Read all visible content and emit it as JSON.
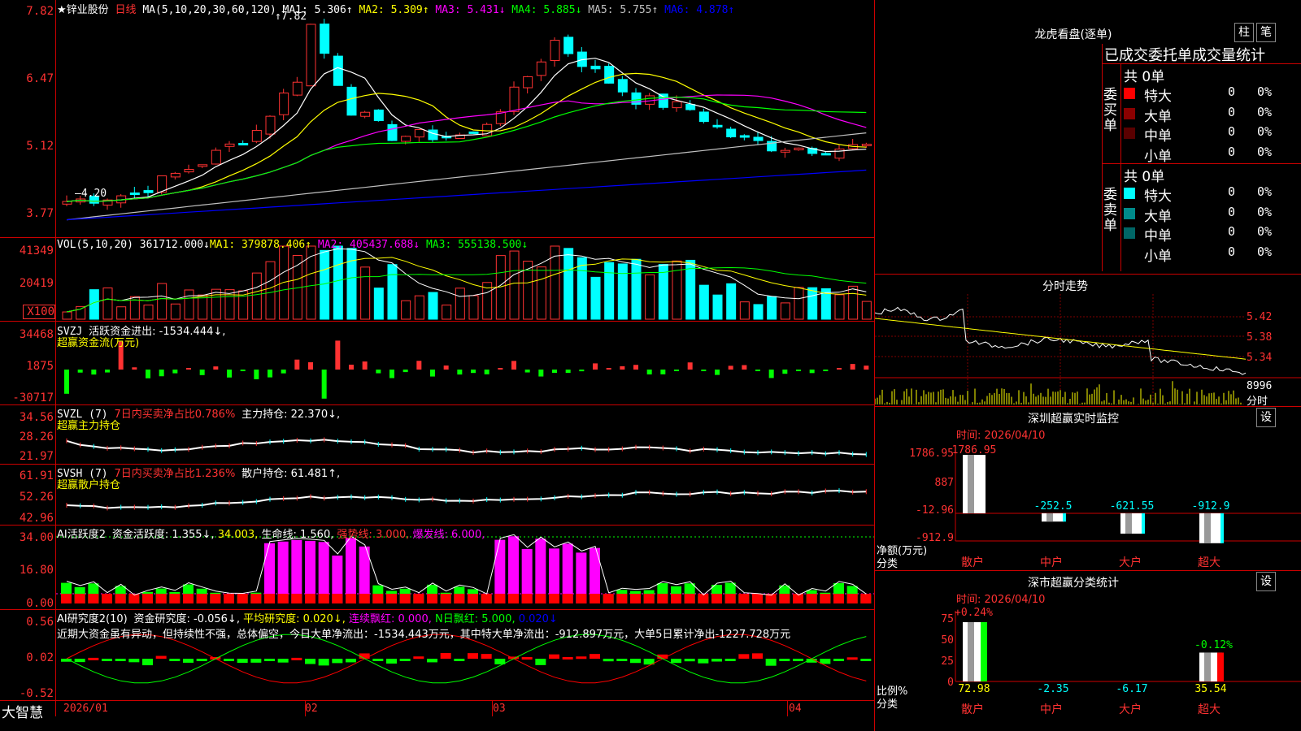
{
  "stock_title": "★锌业股份",
  "period": "日线",
  "main_indicator": {
    "label": "MA(5,10,20,30,60,120)",
    "items": [
      {
        "text": "MA1: 5.306↑",
        "color": "#ffffff"
      },
      {
        "text": "MA2: 5.309↑",
        "color": "#ffff00"
      },
      {
        "text": "MA3: 5.431↓",
        "color": "#ff00ff"
      },
      {
        "text": "MA4: 5.885↓",
        "color": "#00ff00"
      },
      {
        "text": "MA5: 5.755↑",
        "color": "#c0c0c0"
      },
      {
        "text": "MA6: 4.878↑",
        "color": "#0000ff"
      }
    ],
    "high_mark": "7.82",
    "low_mark": "4.20"
  },
  "price_axis": [
    "7.82",
    "6.47",
    "5.12",
    "3.77"
  ],
  "vol_panel": {
    "label": "VOL(5,10,20)",
    "value": "361712.000↓",
    "ma1": "MA1: 379878.406↑",
    "ma2": "MA2: 405437.688↓",
    "ma3": "MA3: 555138.500↓",
    "axis": [
      "41349",
      "20419",
      "X100"
    ]
  },
  "svzj_panel": {
    "label": "SVZJ",
    "title": "活跃资金进出: -1534.444↓,",
    "subtitle": "超赢资金流(万元)",
    "axis": [
      "34468",
      "1875",
      "-30717"
    ]
  },
  "svzl_panel": {
    "label": "SVZL (7)",
    "title": "7日内买卖净占比0.786%",
    "extra": "主力持仓: 22.370↓,",
    "subtitle": "超赢主力持仓",
    "axis": [
      "34.56",
      "28.26",
      "21.97"
    ]
  },
  "svsh_panel": {
    "label": "SVSH (7)",
    "title": "7日内买卖净占比1.236%",
    "extra": "散户持仓: 61.481↑,",
    "subtitle": "超赢散户持仓",
    "axis": [
      "61.91",
      "52.26",
      "42.96"
    ]
  },
  "ai_active_panel": {
    "label": "AI活跃度2",
    "items": [
      {
        "text": "资金活跃度: 1.355↓,",
        "color": "#ffffff"
      },
      {
        "text": "34.003,",
        "color": "#ffff00"
      },
      {
        "text": "生命线: 1.560,",
        "color": "#ffffff"
      },
      {
        "text": "强势线: 3.000,",
        "color": "#ff3232"
      },
      {
        "text": "爆发线: 6.000,",
        "color": "#ff00ff"
      }
    ],
    "axis": [
      "34.00",
      "16.80",
      "0.00"
    ]
  },
  "ai_research_panel": {
    "label": "AI研究度2(10)",
    "items": [
      {
        "text": "资金研究度: -0.056↓,",
        "color": "#ffffff"
      },
      {
        "text": "平均研究度: 0.020↓,",
        "color": "#ffff00"
      },
      {
        "text": "连续飘红: 0.000,",
        "color": "#ff00ff"
      },
      {
        "text": "N日飘红: 5.000,",
        "color": "#00ff00"
      },
      {
        "text": "0.020↓",
        "color": "#0000ff"
      }
    ],
    "comment": "近期大资金虽有异动，但持续性不强，总体偏空，今日大单净流出：-1534.443万元，其中特大单净流出：-912.897万元，大单5日累计净出-1227.728万元",
    "axis": [
      "0.56",
      "0.02",
      "-0.52"
    ]
  },
  "date_axis": [
    "2026/01",
    "02",
    "03",
    "04"
  ],
  "brand": "大智慧",
  "lhb": {
    "title": "龙虎看盘(逐单)",
    "btn_zhu": "柱",
    "btn_bi": "笔",
    "tabs": "已成交委托单成交量统计",
    "buy": {
      "side_label": "委买单",
      "total": "共 0单",
      "rows": [
        {
          "name": "特大",
          "val": "0",
          "pct": "0%",
          "color": "#ff0000"
        },
        {
          "name": "大单",
          "val": "0",
          "pct": "0%",
          "color": "#8b0000"
        },
        {
          "name": "中单",
          "val": "0",
          "pct": "0%",
          "color": "#5a0000"
        },
        {
          "name": "小单",
          "val": "0",
          "pct": "0%",
          "color": "#000000"
        }
      ]
    },
    "sell": {
      "side_label": "委卖单",
      "total": "共 0单",
      "rows": [
        {
          "name": "特大",
          "val": "0",
          "pct": "0%",
          "color": "#00ffff"
        },
        {
          "name": "大单",
          "val": "0",
          "pct": "0%",
          "color": "#008b8b"
        },
        {
          "name": "中单",
          "val": "0",
          "pct": "0%",
          "color": "#006666"
        },
        {
          "name": "小单",
          "val": "0",
          "pct": "0%",
          "color": "#000000"
        }
      ]
    }
  },
  "intraday": {
    "title": "分时走势",
    "prices": [
      "5.42",
      "5.38",
      "5.34"
    ],
    "vol_max": "8996",
    "footer": "分时"
  },
  "sz_monitor": {
    "title": "深圳超赢实时监控",
    "btn": "设",
    "time": "时间: 2026/04/10",
    "axis": [
      "1786.95",
      "887",
      "-12.96",
      "-912.9"
    ],
    "net_label": "净额(万元)",
    "cat_label": "分类",
    "cats": [
      "散户",
      "中户",
      "大户",
      "超大"
    ],
    "values": [
      "1786.95",
      "-252.5",
      "-621.55",
      "-912.9"
    ]
  },
  "sz_class": {
    "title": "深市超赢分类统计",
    "btn": "设",
    "time": "时间: 2026/04/10",
    "axis": [
      "75",
      "50",
      "25",
      "0"
    ],
    "pct_label": "比例%",
    "cat_label": "分类",
    "top_labels": [
      "+0.24%",
      "-0.12%"
    ],
    "cats": [
      "散户",
      "中户",
      "大户",
      "超大"
    ],
    "values": [
      "72.98",
      "-2.35",
      "-6.17",
      "35.54"
    ]
  }
}
